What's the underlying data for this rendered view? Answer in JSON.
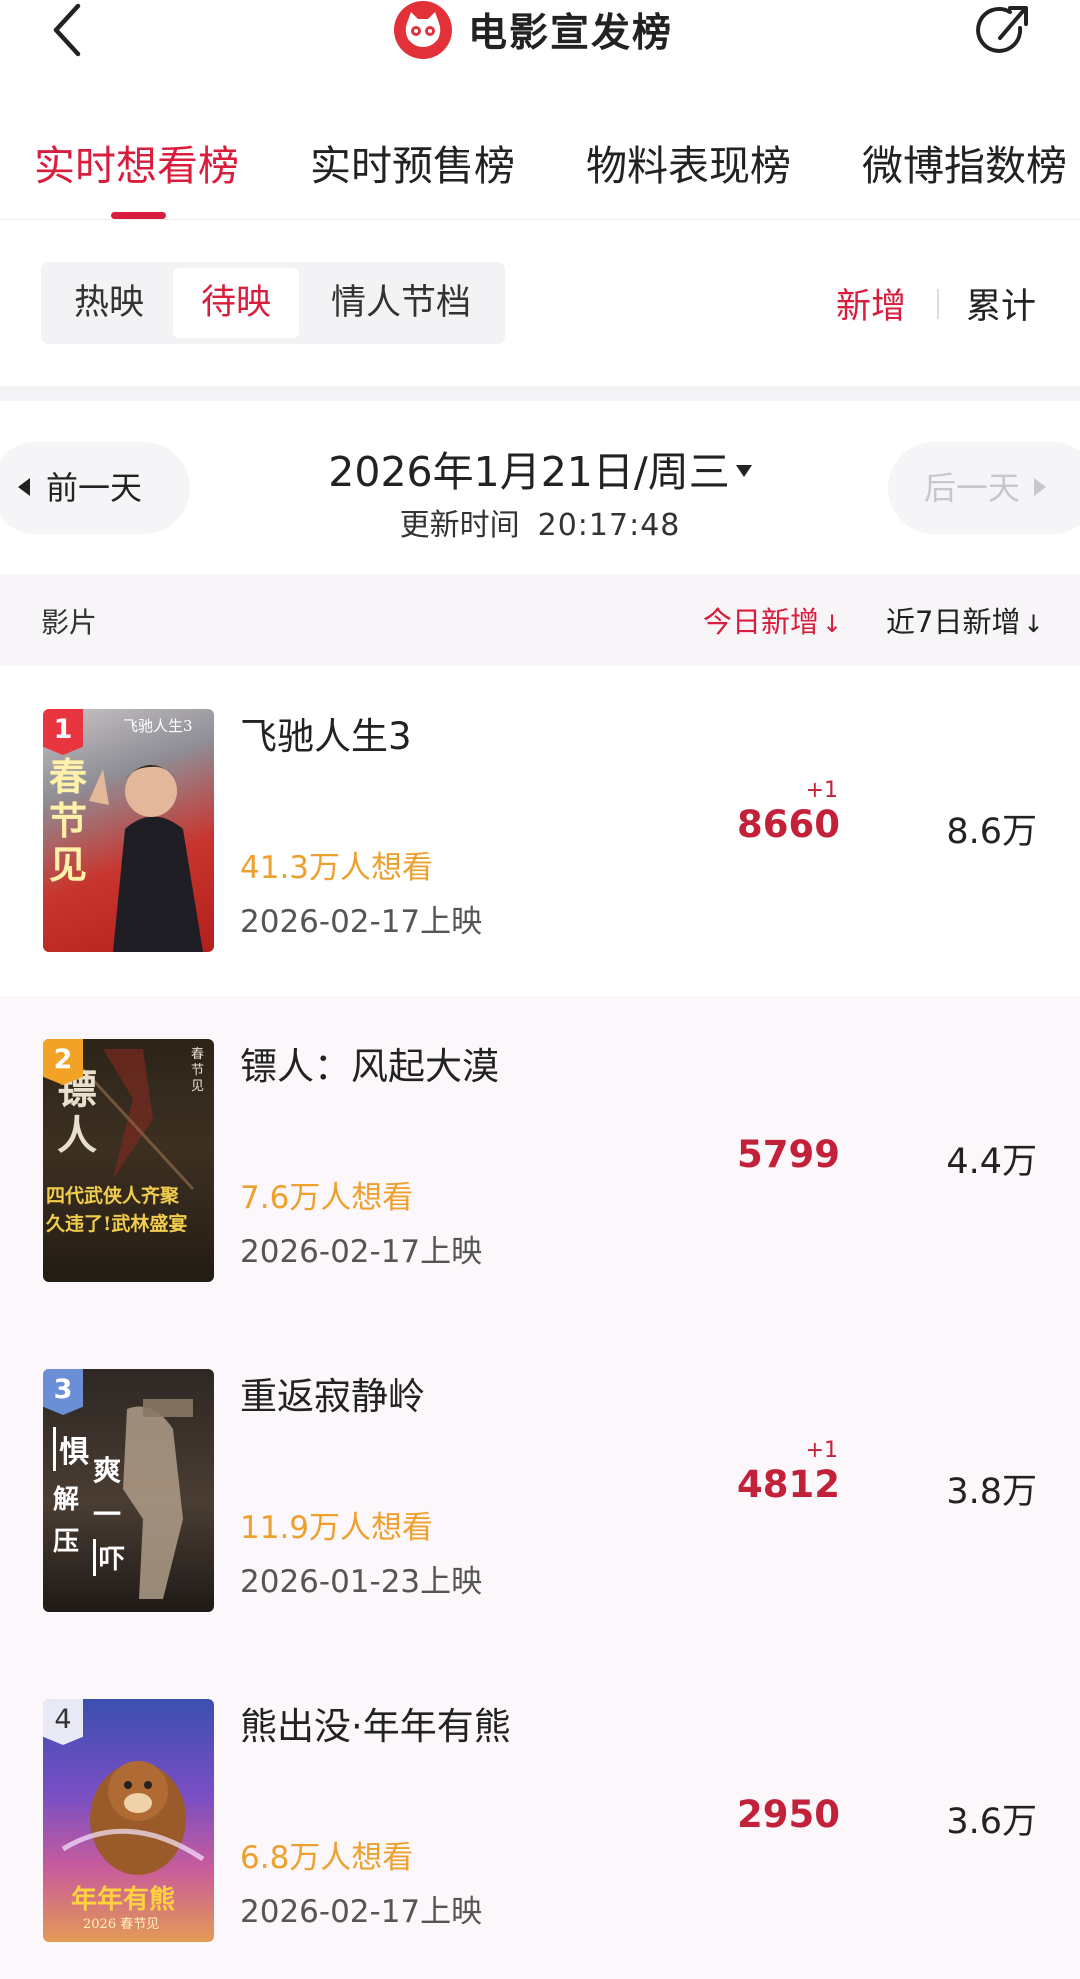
{
  "header": {
    "title": "电影宣发榜"
  },
  "main_tabs": [
    {
      "label": "实时想看榜",
      "active": true
    },
    {
      "label": "实时预售榜",
      "active": false
    },
    {
      "label": "物料表现榜",
      "active": false
    },
    {
      "label": "微博指数榜",
      "active": false
    }
  ],
  "filters": {
    "segments": [
      {
        "label": "热映",
        "active": false
      },
      {
        "label": "待映",
        "active": true
      },
      {
        "label": "情人节档",
        "active": false
      }
    ],
    "modes": [
      {
        "label": "新增",
        "active": true
      },
      {
        "label": "累计",
        "active": false
      }
    ]
  },
  "date_nav": {
    "prev_label": "前一天",
    "next_label": "后一天",
    "date": "2026年1月21日/周三",
    "update_label": "更新时间",
    "update_time": "20:17:48"
  },
  "columns": {
    "film": "影片",
    "today": "今日新增",
    "week": "近7日新增",
    "sort_arrow": "↓"
  },
  "movies": [
    {
      "rank": "1",
      "title": "飞驰人生3",
      "want": "41.3万人想看",
      "release": "2026-02-17上映",
      "today": "8660",
      "delta": "+1",
      "week": "8.6万",
      "poster": {
        "big": "春节见",
        "small": "飞驰人生3"
      }
    },
    {
      "rank": "2",
      "title": "镖人：风起大漠",
      "want": "7.6万人想看",
      "release": "2026-02-17上映",
      "today": "5799",
      "delta": "",
      "week": "4.4万",
      "poster": {
        "big": "镖人",
        "line1": "四代武侠人齐聚",
        "line2": "久违了!武林盛宴",
        "small": "春节见"
      }
    },
    {
      "rank": "3",
      "title": "重返寂静岭",
      "want": "11.9万人想看",
      "release": "2026-01-23上映",
      "today": "4812",
      "delta": "+1",
      "week": "3.8万",
      "poster": {
        "big": "惧",
        "big2": "解压",
        "side": "爽一",
        "side2": "吓"
      }
    },
    {
      "rank": "4",
      "title": "熊出没·年年有熊",
      "want": "6.8万人想看",
      "release": "2026-02-17上映",
      "today": "2950",
      "delta": "",
      "week": "3.6万",
      "poster": {
        "big": "年年有熊",
        "small": "2026 春节见"
      }
    }
  ],
  "colors": {
    "accent": "#d81e3c",
    "want": "#eea02f",
    "rank1": "#e8353f",
    "rank2": "#f2a325",
    "rank3": "#6b8fd6"
  }
}
